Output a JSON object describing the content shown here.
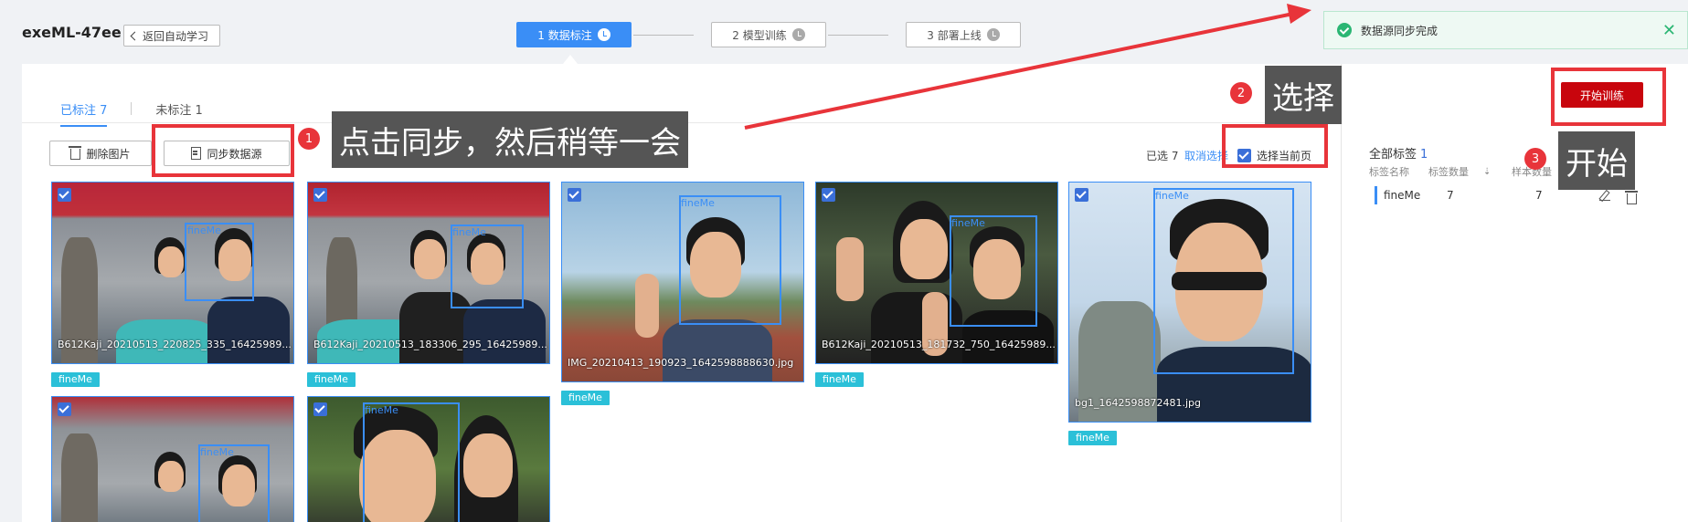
{
  "header": {
    "project_name": "exeML-47ee",
    "back_label": "返回自动学习",
    "steps": [
      {
        "label": "1 数据标注",
        "active": true
      },
      {
        "label": "2 模型训练",
        "active": false
      },
      {
        "label": "3 部署上线",
        "active": false
      }
    ]
  },
  "toast": {
    "message": "数据源同步完成",
    "close": "✕"
  },
  "tabs": {
    "labeled": "已标注 7",
    "unlabeled": "未标注 1"
  },
  "toolbar": {
    "delete_label": "删除图片",
    "sync_label": "同步数据源",
    "selected_prefix": "已选 7",
    "cancel_label": "取消选择",
    "select_page_label": "选择当前页"
  },
  "images": [
    {
      "filename": "B612Kaji_20210513_220825_335_16425989...",
      "box_label": "fineMe",
      "tag": "fineMe"
    },
    {
      "filename": "B612Kaji_20210513_183306_295_16425989...",
      "box_label": "fineMe",
      "tag": "fineMe"
    },
    {
      "filename": "IMG_20210413_190923_1642598888630.jpg",
      "box_label": "fineMe",
      "tag": "fineMe"
    },
    {
      "filename": "B612Kaji_20210513_181732_750_16425989...",
      "box_label": "fineMe",
      "tag": "fineMe"
    },
    {
      "filename": "bg1_1642598872481.jpg",
      "box_label": "fineMe",
      "tag": "fineMe"
    },
    {
      "filename": "",
      "box_label": "fineMe",
      "tag": ""
    },
    {
      "filename": "",
      "box_label": "fineMe",
      "tag": ""
    }
  ],
  "right_panel": {
    "title": "全部标签",
    "count": "1",
    "headers": [
      "标签名称",
      "标签数量",
      "样本数量"
    ],
    "row": {
      "name": "fineMe",
      "label_count": "7",
      "sample_count": "7"
    },
    "train_label": "开始训练"
  },
  "annotations": {
    "callout1": "点击同步，然后稍等一会",
    "callout2": "选择",
    "callout3": "开始",
    "num1": "1",
    "num2": "2",
    "num3": "3"
  },
  "colors": {
    "accent": "#3a8ef6",
    "tag": "#2bc0d8",
    "train": "#c8050d",
    "annotation_red": "#e8343a",
    "success": "#2bb673"
  }
}
